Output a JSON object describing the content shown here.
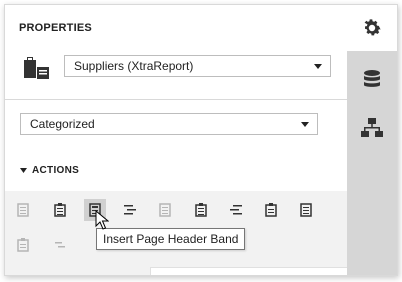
{
  "panel": {
    "title": "PROPERTIES"
  },
  "component_select": {
    "value": "Suppliers (XtraReport)",
    "icon": "report-component-icon"
  },
  "view_select": {
    "value": "Categorized"
  },
  "actions": {
    "label": "ACTIONS",
    "expanded": true,
    "buttons": [
      {
        "name": "band-action-1",
        "icon": "band-icon",
        "enabled": false
      },
      {
        "name": "band-action-2",
        "icon": "band-icon",
        "enabled": true
      },
      {
        "name": "insert-page-header-band",
        "icon": "band-icon",
        "enabled": true,
        "hovered": true
      },
      {
        "name": "band-action-4",
        "icon": "band-lines-icon",
        "enabled": true
      },
      {
        "name": "band-action-5",
        "icon": "band-icon",
        "enabled": false
      },
      {
        "name": "band-action-6",
        "icon": "band-icon",
        "enabled": true
      },
      {
        "name": "band-action-7",
        "icon": "band-lines-icon",
        "enabled": true
      },
      {
        "name": "band-action-8",
        "icon": "band-icon",
        "enabled": true
      },
      {
        "name": "band-action-9",
        "icon": "band-icon",
        "enabled": true
      },
      {
        "name": "band-action-10",
        "icon": "band-icon",
        "enabled": false
      },
      {
        "name": "band-action-11",
        "icon": "band-lines-icon",
        "enabled": false
      }
    ]
  },
  "tooltip": {
    "text": "Insert Page Header Band"
  },
  "right_tabs": [
    {
      "icon": "gear-icon",
      "active": true
    },
    {
      "icon": "database-icon",
      "active": false
    },
    {
      "icon": "hierarchy-icon",
      "active": false
    }
  ],
  "colors": {
    "sidebar_bg": "#d6d6d6",
    "toolbar_bg": "#f2f2f2",
    "icon_dark": "#333333",
    "icon_disabled": "#b5b5b5"
  }
}
